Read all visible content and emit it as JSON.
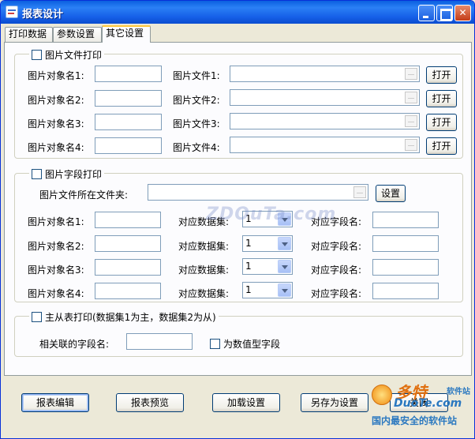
{
  "window": {
    "title": "报表设计"
  },
  "tabs": [
    "打印数据",
    "参数设置",
    "其它设置"
  ],
  "image_file_group": {
    "legend": "图片文件打印",
    "rows": [
      {
        "name_label": "图片对象名1:",
        "file_label": "图片文件1:",
        "button": "打开"
      },
      {
        "name_label": "图片对象名2:",
        "file_label": "图片文件2:",
        "button": "打开"
      },
      {
        "name_label": "图片对象名3:",
        "file_label": "图片文件3:",
        "button": "打开"
      },
      {
        "name_label": "图片对象名4:",
        "file_label": "图片文件4:",
        "button": "打开"
      }
    ]
  },
  "image_field_group": {
    "legend": "图片字段打印",
    "folder_label": "图片文件所在文件夹:",
    "folder_button": "设置",
    "rows": [
      {
        "name_label": "图片对象名1:",
        "dataset_label": "对应数据集:",
        "dataset_value": "1",
        "field_label": "对应字段名:"
      },
      {
        "name_label": "图片对象名2:",
        "dataset_label": "对应数据集:",
        "dataset_value": "1",
        "field_label": "对应字段名:"
      },
      {
        "name_label": "图片对象名3:",
        "dataset_label": "对应数据集:",
        "dataset_value": "1",
        "field_label": "对应字段名:"
      },
      {
        "name_label": "图片对象名4:",
        "dataset_label": "对应数据集:",
        "dataset_value": "1",
        "field_label": "对应字段名:"
      }
    ]
  },
  "master_detail_group": {
    "legend": "主从表打印(数据集1为主，数据集2为从)",
    "field_label": "相关联的字段名:",
    "numeric_checkbox": "为数值型字段"
  },
  "bottom_buttons": [
    "报表编辑",
    "报表预览",
    "加载设置",
    "另存为设置",
    "关闭"
  ],
  "watermark": {
    "center": "ZDOuTa.com",
    "site_name": "多特",
    "site_tag": "软件站",
    "site_domain": "DuoTe.com",
    "slogan": "国内最安全的软件站"
  }
}
